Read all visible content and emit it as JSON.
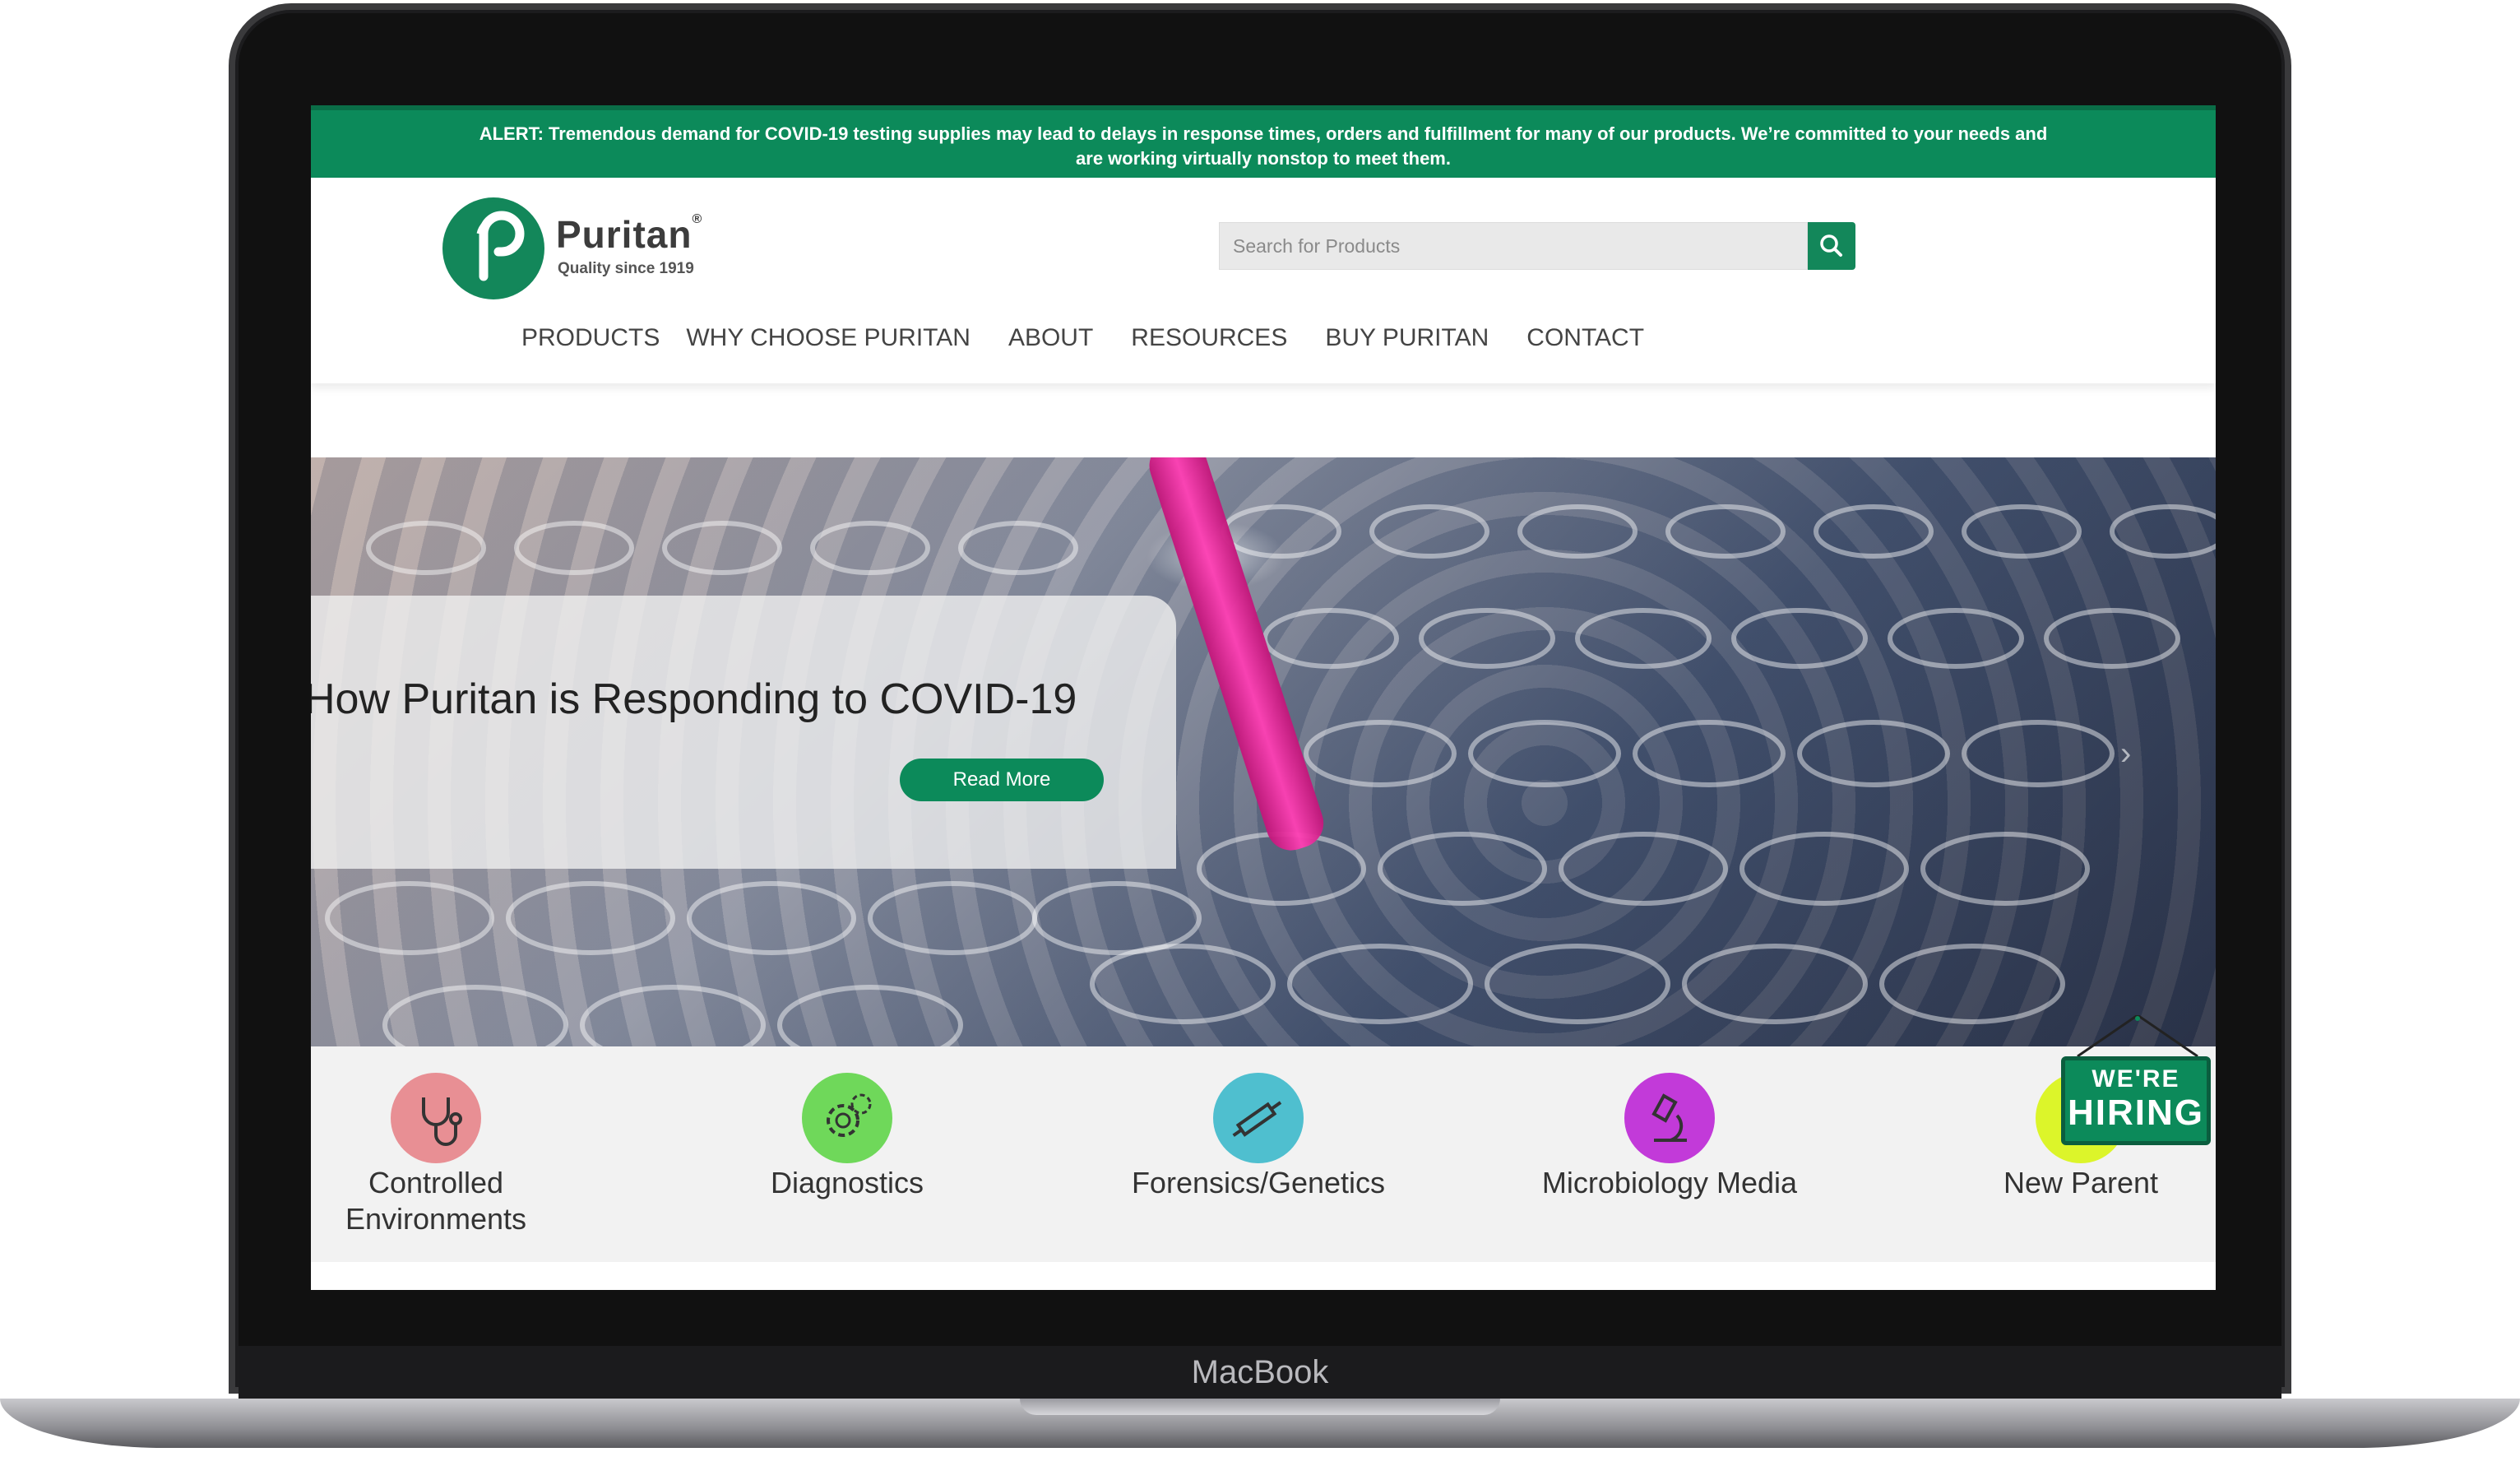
{
  "device": {
    "brand_label": "MacBook"
  },
  "alert": {
    "text": "ALERT: Tremendous demand for COVID-19 testing supplies may lead to delays in response times, orders and fulfillment for many of our products. We’re committed to your needs and are working virtually nonstop to meet them."
  },
  "header": {
    "logo_name": "Puritan",
    "logo_registered": "®",
    "logo_tagline": "Quality since 1919",
    "search_placeholder": "Search for Products",
    "nav": [
      "PRODUCTS",
      "WHY CHOOSE PURITAN",
      "ABOUT",
      "RESOURCES",
      "BUY PURITAN",
      "CONTACT"
    ]
  },
  "hero": {
    "title": "How Puritan is Responding to COVID-19",
    "button_label": "Read More",
    "next_chevron": "›"
  },
  "categories": [
    {
      "label_line1": "Controlled",
      "label_line2": "Environments",
      "icon": "stethoscope-icon",
      "color": "#e88f94"
    },
    {
      "label_line1": "Diagnostics",
      "label_line2": "",
      "icon": "gears-icon",
      "color": "#6fd85a"
    },
    {
      "label_line1": "Forensics/Genetics",
      "label_line2": "",
      "icon": "syringe-icon",
      "color": "#4fbfcf"
    },
    {
      "label_line1": "Microbiology Media",
      "label_line2": "",
      "icon": "microscope-icon",
      "color": "#c23ad9"
    },
    {
      "label_line1": "New Parent",
      "label_line2": "",
      "icon": "baby-icon",
      "color": "#dcf52a"
    }
  ],
  "hiring_sign": {
    "line1": "WE'RE",
    "line2": "HIRING"
  },
  "colors": {
    "brand_green": "#0c8a5a",
    "accent_pink": "#ff3fb4"
  }
}
